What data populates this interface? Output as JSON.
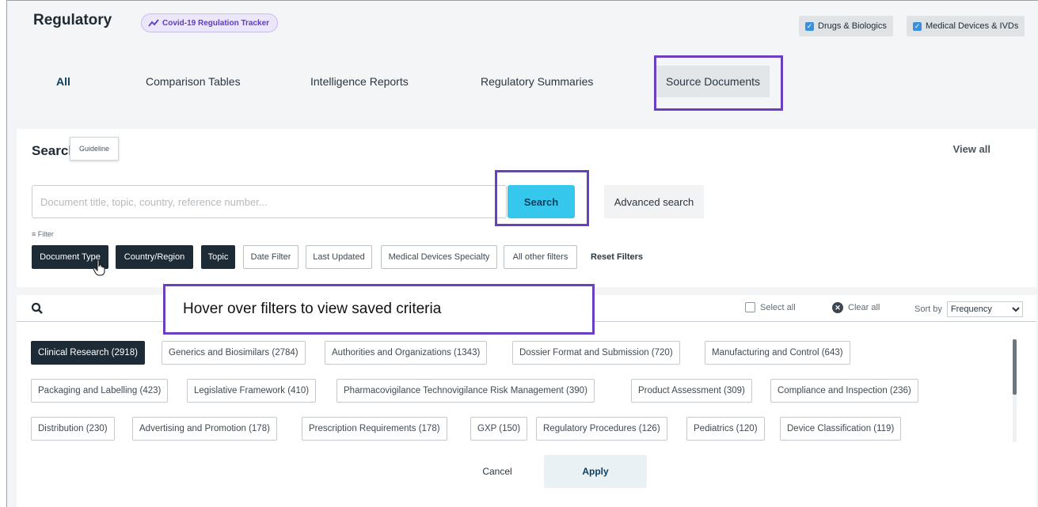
{
  "header": {
    "brand": "Regulatory",
    "covid_tracker": "Covid-19 Regulation Tracker",
    "toggles": [
      "Drugs & Biologics",
      "Medical Devices & IVDs"
    ]
  },
  "tabs": [
    "All",
    "Comparison Tables",
    "Intelligence Reports",
    "Regulatory Summaries",
    "Source Documents"
  ],
  "search": {
    "title": "Search",
    "view_all": "View all",
    "placeholder": "Document title, topic, country, reference number...",
    "button": "Search",
    "advanced": "Advanced search"
  },
  "filters": {
    "label": "Filter",
    "chips": [
      "Document Type",
      "Country/Region",
      "Topic",
      "Date Filter",
      "Last Updated",
      "Medical Devices Specialty",
      "All other filters"
    ],
    "reset": "Reset Filters",
    "tooltip": "Guideline"
  },
  "panel": {
    "select_all": "Select all",
    "clear_all": "Clear all",
    "sort_label": "Sort by",
    "sort_value": "Frequency",
    "topics": [
      "Clinical Research (2918)",
      "Generics and Biosimilars (2784)",
      "Authorities and Organizations (1343)",
      "Dossier Format and Submission (720)",
      "Manufacturing and Control (643)",
      "Packaging and Labelling (423)",
      "Legislative Framework (410)",
      "Pharmacovigilance Technovigilance Risk Management (390)",
      "Product Assessment (309)",
      "Compliance and Inspection (236)",
      "Distribution (230)",
      "Advertising and Promotion (178)",
      "Prescription Requirements (178)",
      "GXP (150)",
      "Regulatory Procedures (126)",
      "Pediatrics (120)",
      "Device Classification (119)"
    ],
    "cancel": "Cancel",
    "apply": "Apply"
  },
  "annotation": "Hover over filters to view saved criteria",
  "colors": {
    "highlight": "#6a3fc2",
    "search_button": "#36c7ed",
    "dark_chip": "#1c2b36"
  }
}
